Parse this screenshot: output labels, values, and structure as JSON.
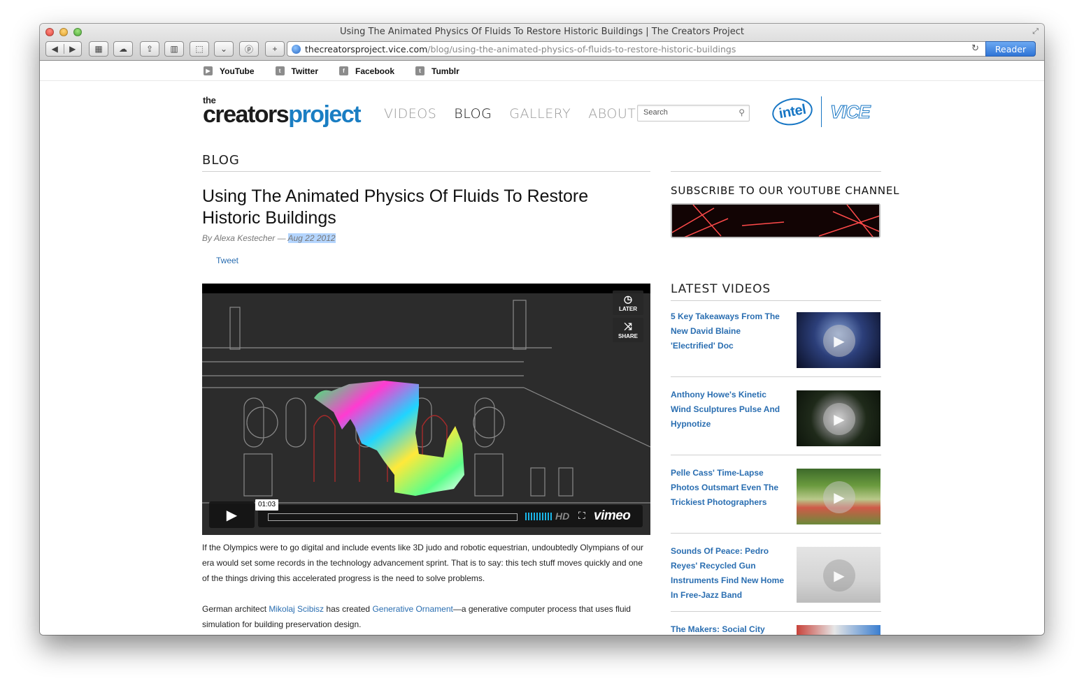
{
  "window": {
    "title": "Using The Animated Physics Of Fluids To Restore Historic Buildings | The Creators Project"
  },
  "toolbar": {
    "url_domain": "thecreatorsproject.vice.com",
    "url_path": "/blog/using-the-animated-physics-of-fluids-to-restore-historic-buildings",
    "reader_label": "Reader"
  },
  "social": [
    {
      "label": "YouTube",
      "icon": "youtube-icon"
    },
    {
      "label": "Twitter",
      "icon": "twitter-icon"
    },
    {
      "label": "Facebook",
      "icon": "facebook-icon"
    },
    {
      "label": "Tumblr",
      "icon": "tumblr-icon"
    }
  ],
  "logo": {
    "the": "the",
    "creators": "creators",
    "project": "project"
  },
  "nav": [
    {
      "label": "VIDEOS"
    },
    {
      "label": "BLOG",
      "active": true
    },
    {
      "label": "GALLERY"
    },
    {
      "label": "ABOUT"
    }
  ],
  "search": {
    "placeholder": "Search"
  },
  "sponsors": {
    "intel": "intel",
    "vice": "VICE"
  },
  "article": {
    "section": "BLOG",
    "title": "Using The Animated Physics Of Fluids To Restore Historic Buildings",
    "author": "By Alexa Kestecher — ",
    "date": "Aug 22 2012",
    "tweet": "Tweet",
    "video": {
      "later": "LATER",
      "share": "SHARE",
      "timecode": "01:03",
      "hd": "HD",
      "brand": "vimeo",
      "progress": 0
    },
    "para1": "If the Olympics were to go digital and include events like 3D judo and robotic equestrian, undoubtedly Olympians of our era would set some records in the technology advancement sprint. That is to say: this tech stuff moves quickly and one of the things driving this accelerated progress is the need to solve problems.",
    "para2_a": "German architect ",
    "para2_link1": "Mikolaj Scibisz",
    "para2_b": " has created ",
    "para2_link2": "Generative Ornament",
    "para2_c": "—a generative computer process that uses fluid simulation for building preservation design."
  },
  "sidebar": {
    "subscribe_title": "SUBSCRIBE TO OUR YOUTUBE CHANNEL",
    "latest_title": "LATEST VIDEOS",
    "videos": [
      {
        "title": "5 Key Takeaways From The New David Blaine 'Electrified' Doc"
      },
      {
        "title": "Anthony Howe's Kinetic Wind Sculptures Pulse And Hypnotize"
      },
      {
        "title": "Pelle Cass' Time-Lapse Photos Outsmart Even The Trickiest Photographers"
      },
      {
        "title": "Sounds Of Peace: Pedro Reyes' Recycled Gun Instruments Find New Home In Free-Jazz Band"
      },
      {
        "title": "The Makers: Social City"
      }
    ]
  },
  "colors": {
    "link": "#2a6eb1",
    "brand_blue": "#1a7ec3",
    "reader_blue": "#2f74d6",
    "vimeo_blue": "#1ab7ea"
  }
}
